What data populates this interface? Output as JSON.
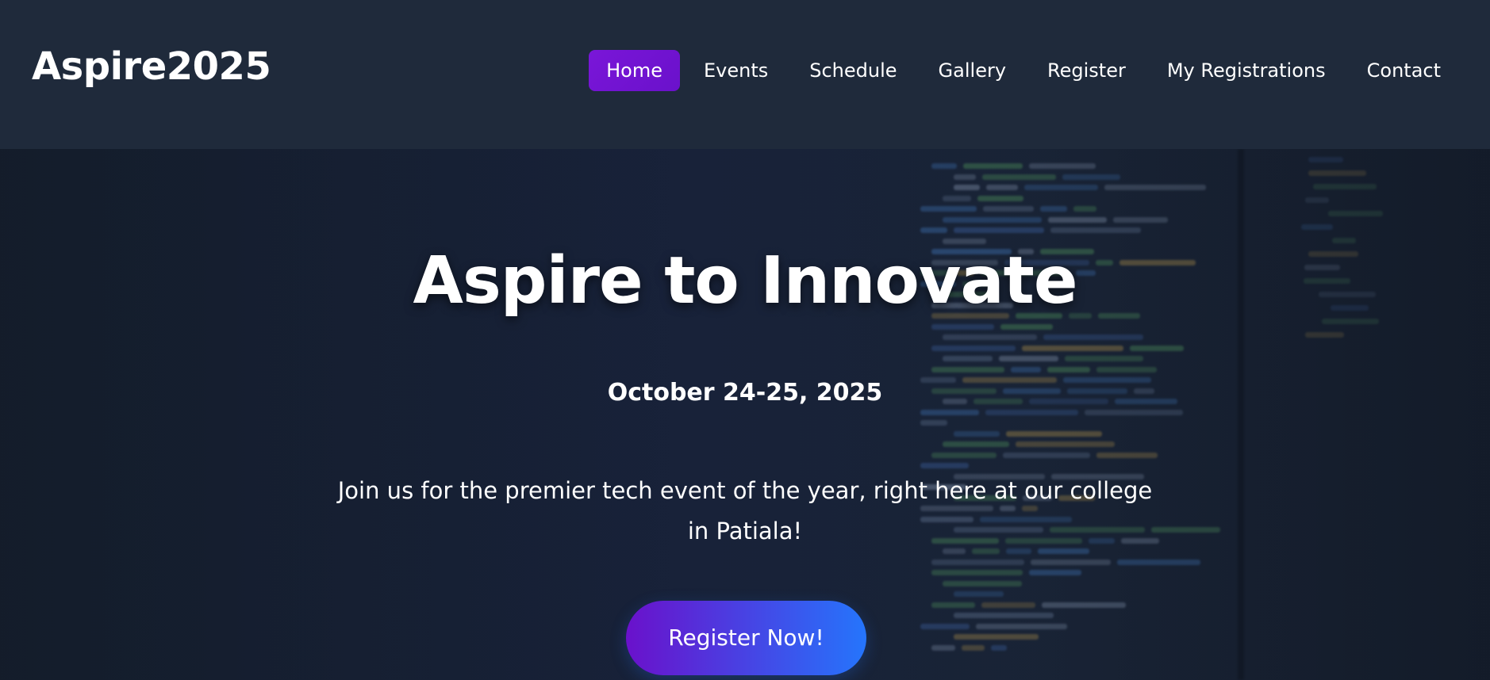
{
  "header": {
    "brand": "Aspire2025",
    "nav": [
      {
        "label": "Home",
        "active": true
      },
      {
        "label": "Events",
        "active": false
      },
      {
        "label": "Schedule",
        "active": false
      },
      {
        "label": "Gallery",
        "active": false
      },
      {
        "label": "Register",
        "active": false
      },
      {
        "label": "My Registrations",
        "active": false
      },
      {
        "label": "Contact",
        "active": false
      }
    ]
  },
  "hero": {
    "title": "Aspire to Innovate",
    "date": "October 24-25, 2025",
    "description": "Join us for the premier tech event of the year, right here at our college in Patiala!",
    "cta_label": "Register Now!"
  },
  "colors": {
    "header_bg": "#1f2a3b",
    "active_nav": "#6a11cb",
    "cta_gradient_start": "#6a11cb",
    "cta_gradient_end": "#2575fc",
    "text": "#ffffff"
  }
}
